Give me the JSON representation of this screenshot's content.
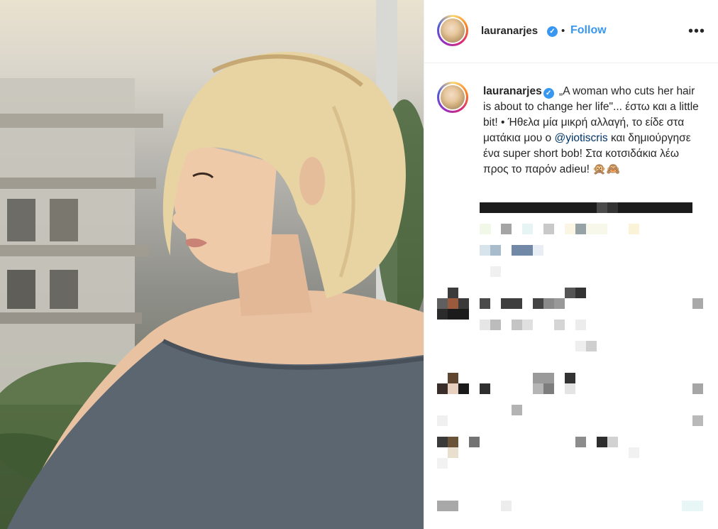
{
  "post": {
    "username": "lauranarjes",
    "separator": "•",
    "follow_label": "Follow",
    "more_label": "•••",
    "caption_user": "lauranarjes",
    "caption_part1": "„A woman who cuts her hair is about to change her life\"... έστω και a little bit! • Ήθελα μία μικρή αλλαγή, το είδε στα ματάκια μου ο",
    "mention": "@yiotiscris",
    "caption_part2": "και δημιούργησε ένα super short bob! Στα κοτσιδάκια λέω προς το παρόν adieu!",
    "caption_emoji": "🙊🙈"
  },
  "colors": {
    "accent": "#3897f0",
    "text": "#262626",
    "mention": "#003569",
    "divider": "#efefef"
  },
  "icons": {
    "verified": "verified-badge-icon",
    "more": "more-options-icon"
  }
}
